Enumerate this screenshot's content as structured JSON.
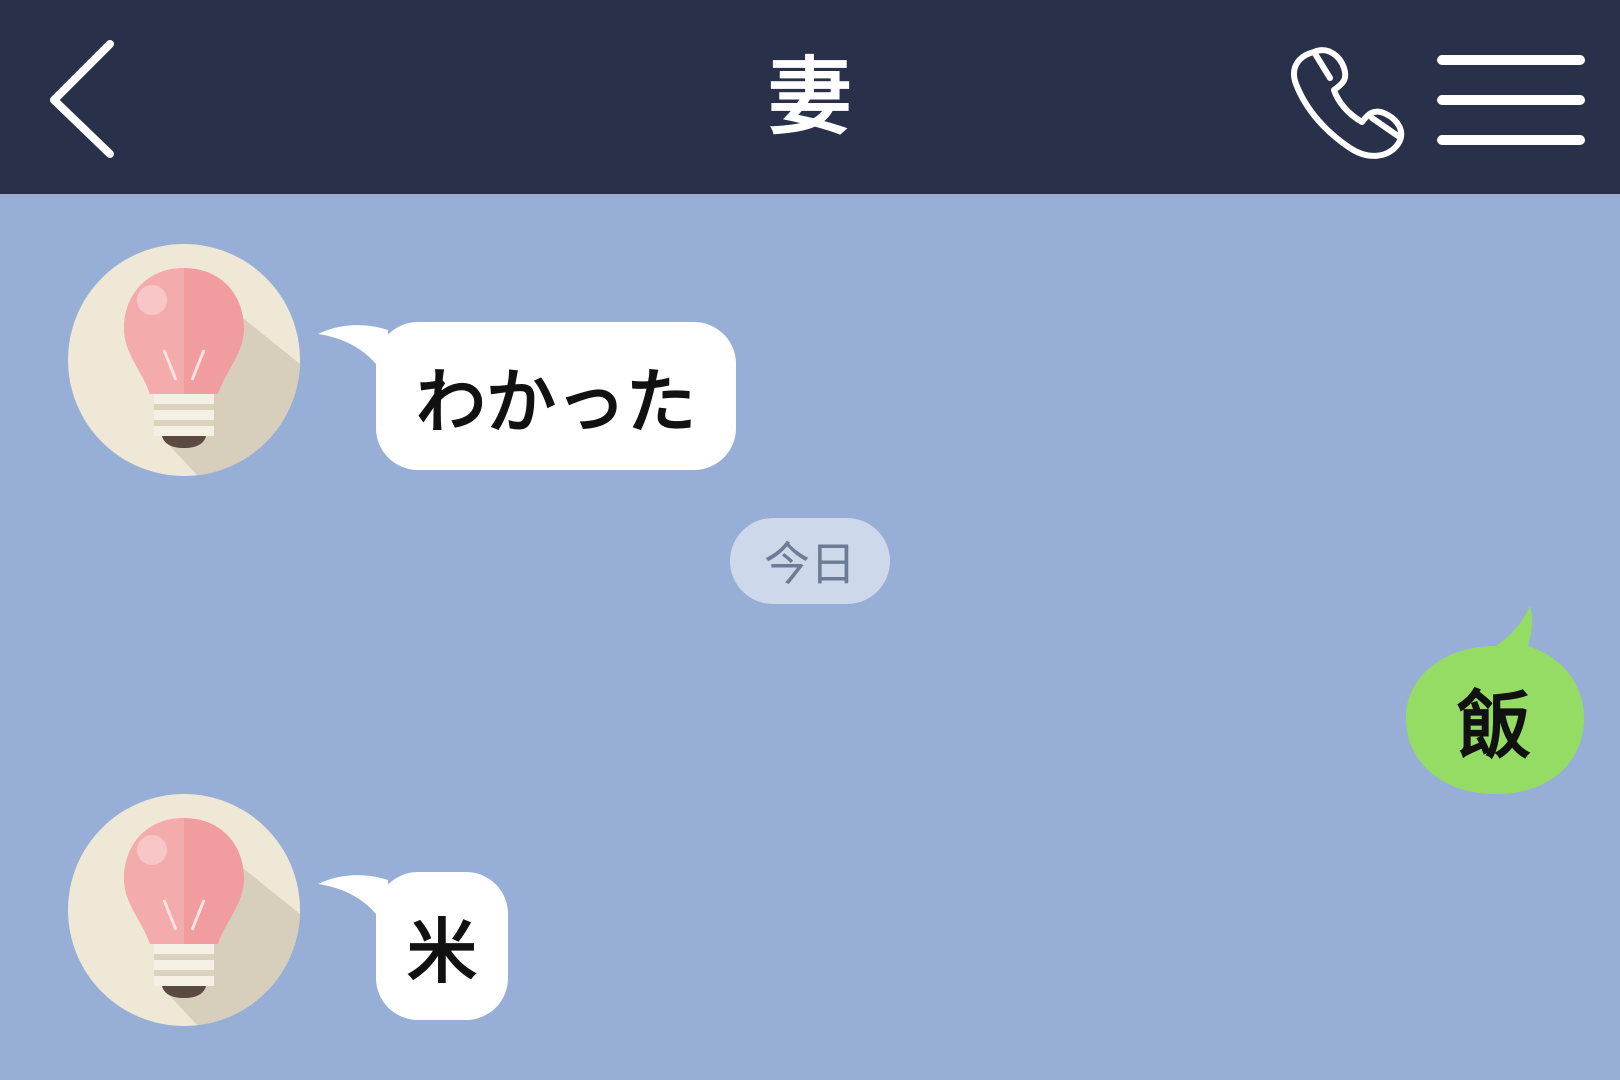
{
  "header": {
    "title": "妻",
    "back_icon": "chevron-left-icon",
    "call_icon": "phone-icon",
    "menu_icon": "hamburger-menu-icon",
    "background_color": "#29314a"
  },
  "chat": {
    "background_color": "#97afd6",
    "date_separator": "今日",
    "messages": [
      {
        "sender": "other",
        "avatar_icon": "light-bulb-avatar-icon",
        "text": "わかった"
      },
      {
        "sender": "self",
        "text": "飯",
        "bubble_color": "#95dc64"
      },
      {
        "sender": "other",
        "avatar_icon": "light-bulb-avatar-icon",
        "text": "米"
      }
    ]
  }
}
